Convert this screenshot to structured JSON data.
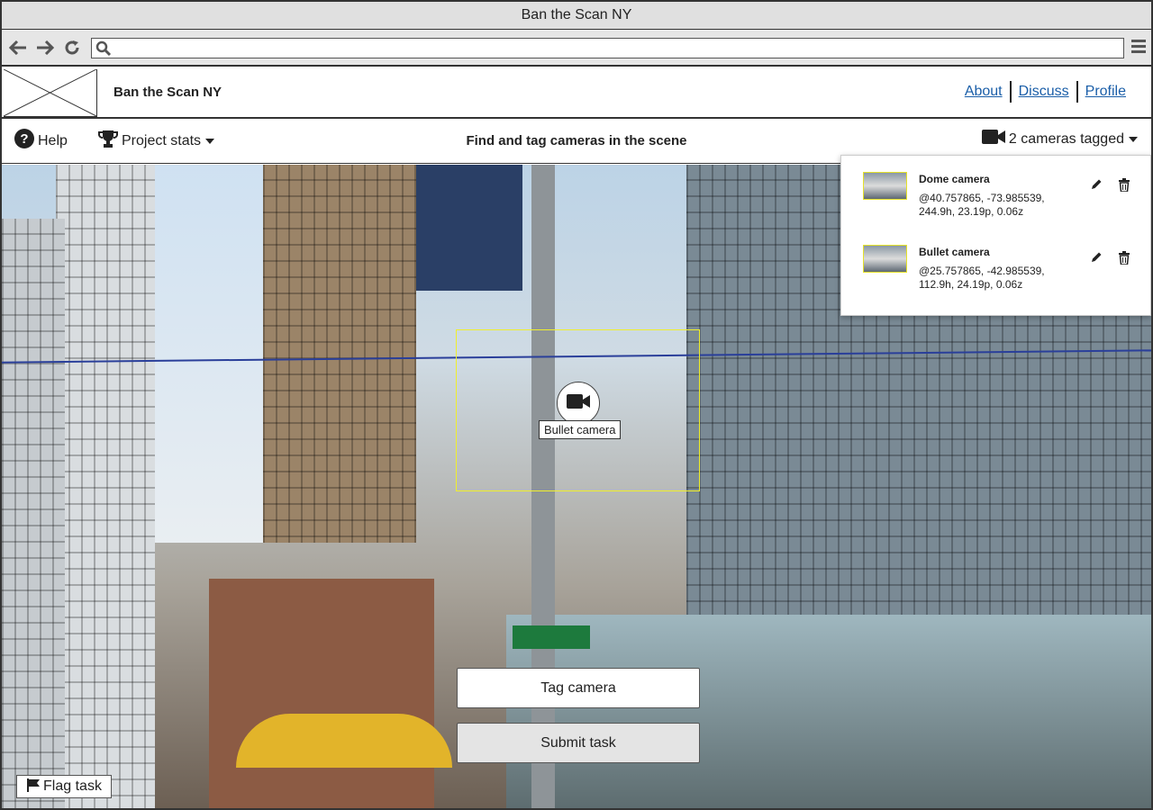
{
  "window": {
    "title": "Ban the Scan NY"
  },
  "browser": {
    "address_value": ""
  },
  "header": {
    "site_title": "Ban the Scan NY",
    "nav": [
      "About",
      "Discuss",
      "Profile"
    ]
  },
  "taskbar": {
    "help_label": "Help",
    "stats_label": "Project stats",
    "task_title": "Find and tag cameras in the scene",
    "tagged_label": "2 cameras tagged"
  },
  "cameras": [
    {
      "name": "Dome camera",
      "coords_line1": "@40.757865, -73.985539,",
      "coords_line2": "244.9h, 23.19p, 0.06z"
    },
    {
      "name": "Bullet camera",
      "coords_line1": "@25.757865, -42.985539,",
      "coords_line2": "112.9h, 24.19p, 0.06z"
    }
  ],
  "scene": {
    "marker_label": "Bullet camera",
    "tag_button": "Tag camera",
    "submit_button": "Submit task",
    "flag_button": "Flag task",
    "selection_color": "#f0ef2c"
  }
}
